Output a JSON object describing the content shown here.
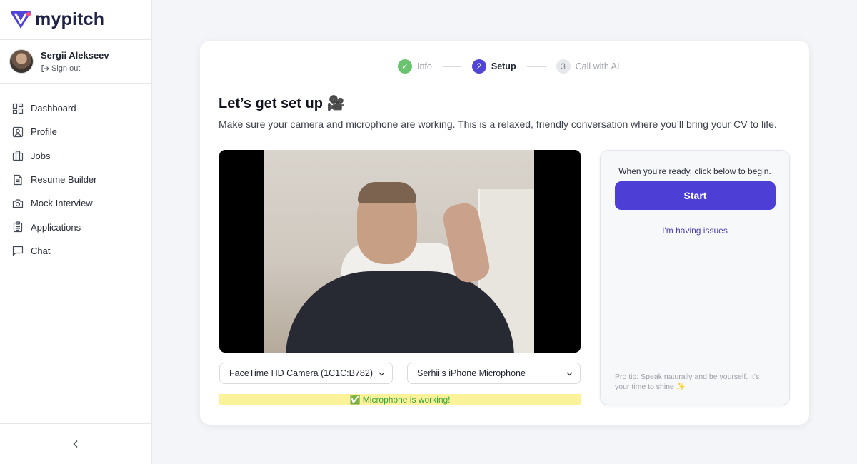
{
  "app": {
    "logo_text": "mypitch",
    "brand_color": "#5145d8"
  },
  "user": {
    "name": "Sergii Alekseev",
    "sign_out_label": "Sign out"
  },
  "sidebar": {
    "items": [
      {
        "label": "Dashboard",
        "icon": "dashboard-icon"
      },
      {
        "label": "Profile",
        "icon": "profile-icon"
      },
      {
        "label": "Jobs",
        "icon": "briefcase-icon"
      },
      {
        "label": "Resume Builder",
        "icon": "document-icon"
      },
      {
        "label": "Mock Interview",
        "icon": "camera-icon"
      },
      {
        "label": "Applications",
        "icon": "clipboard-icon"
      },
      {
        "label": "Chat",
        "icon": "chat-icon"
      }
    ],
    "collapse_icon": "chevron-left-icon"
  },
  "stepper": {
    "steps": [
      {
        "number": "✓",
        "label": "Info",
        "state": "done"
      },
      {
        "number": "2",
        "label": "Setup",
        "state": "active"
      },
      {
        "number": "3",
        "label": "Call with AI",
        "state": "todo"
      }
    ]
  },
  "setup": {
    "title": "Let’s get set up 🎥",
    "subtitle": "Make sure your camera and microphone are working. This is a relaxed, friendly conversation where you’ll bring your CV to life.",
    "camera_select": "FaceTime HD Camera (1C1C:B782)",
    "mic_select": "Serhii’s iPhone Microphone",
    "mic_status": "✅ Microphone is working!"
  },
  "panel": {
    "ready_text": "When you're ready, click below to begin.",
    "start_label": "Start",
    "issues_label": "I'm having issues",
    "pro_tip": "Pro tip: Speak naturally and be yourself. It's your time to shine ✨"
  }
}
